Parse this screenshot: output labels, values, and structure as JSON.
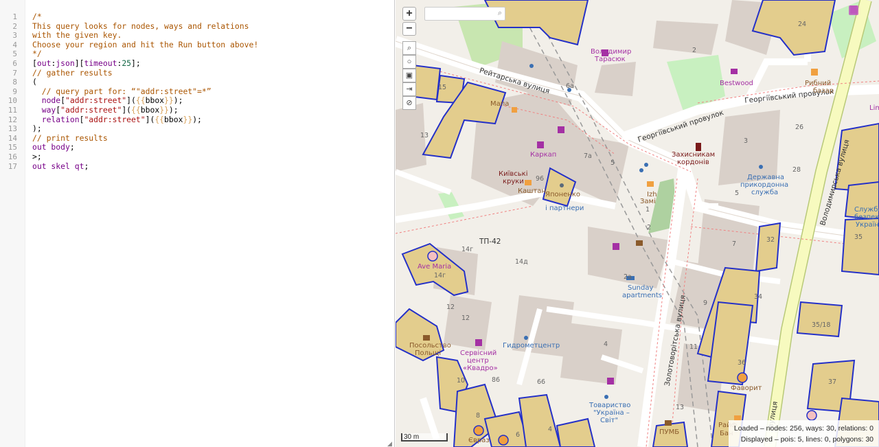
{
  "editor": {
    "line_numbers": [
      "1",
      "2",
      "3",
      "4",
      "5",
      "6",
      "7",
      "8",
      "9",
      "10",
      "11",
      "12",
      "13",
      "14",
      "15",
      "16",
      "17"
    ],
    "lines": [
      [
        {
          "t": "/*",
          "c": "comment"
        }
      ],
      [
        {
          "t": "This query looks for nodes, ways and relations",
          "c": "comment"
        }
      ],
      [
        {
          "t": "with the given key.",
          "c": "comment"
        }
      ],
      [
        {
          "t": "Choose your region and hit the Run button above!",
          "c": "comment"
        }
      ],
      [
        {
          "t": "*/",
          "c": "comment"
        }
      ],
      [
        {
          "t": "[",
          "c": ""
        },
        {
          "t": "out",
          "c": "kw"
        },
        {
          "t": ":",
          "c": ""
        },
        {
          "t": "json",
          "c": "kw"
        },
        {
          "t": "][",
          "c": ""
        },
        {
          "t": "timeout",
          "c": "kw"
        },
        {
          "t": ":",
          "c": ""
        },
        {
          "t": "25",
          "c": "num"
        },
        {
          "t": "];",
          "c": ""
        }
      ],
      [
        {
          "t": "// gather results",
          "c": "comment"
        }
      ],
      [
        {
          "t": "(",
          "c": ""
        }
      ],
      [
        {
          "t": "  // query part for: “\"addr:street\"=*”",
          "c": "comment"
        }
      ],
      [
        {
          "t": "  ",
          "c": ""
        },
        {
          "t": "node",
          "c": "kw"
        },
        {
          "t": "[",
          "c": ""
        },
        {
          "t": "\"addr:street\"",
          "c": "str"
        },
        {
          "t": "](",
          "c": ""
        },
        {
          "t": "{{",
          "c": "br"
        },
        {
          "t": "bbox",
          "c": ""
        },
        {
          "t": "}}",
          "c": "br"
        },
        {
          "t": ");",
          "c": ""
        }
      ],
      [
        {
          "t": "  ",
          "c": ""
        },
        {
          "t": "way",
          "c": "kw"
        },
        {
          "t": "[",
          "c": ""
        },
        {
          "t": "\"addr:street\"",
          "c": "str"
        },
        {
          "t": "](",
          "c": ""
        },
        {
          "t": "{{",
          "c": "br"
        },
        {
          "t": "bbox",
          "c": ""
        },
        {
          "t": "}}",
          "c": "br"
        },
        {
          "t": ");",
          "c": ""
        }
      ],
      [
        {
          "t": "  ",
          "c": ""
        },
        {
          "t": "relation",
          "c": "kw"
        },
        {
          "t": "[",
          "c": ""
        },
        {
          "t": "\"addr:street\"",
          "c": "str"
        },
        {
          "t": "](",
          "c": ""
        },
        {
          "t": "{{",
          "c": "br"
        },
        {
          "t": "bbox",
          "c": ""
        },
        {
          "t": "}}",
          "c": "br"
        },
        {
          "t": ");",
          "c": ""
        }
      ],
      [
        {
          "t": ");",
          "c": ""
        }
      ],
      [
        {
          "t": "// print results",
          "c": "comment"
        }
      ],
      [
        {
          "t": "out body",
          "c": "kw"
        },
        {
          "t": ";",
          "c": ""
        }
      ],
      [
        {
          "t": ">;",
          "c": ""
        }
      ],
      [
        {
          "t": "out skel qt",
          "c": "kw"
        },
        {
          "t": ";",
          "c": ""
        }
      ]
    ]
  },
  "map": {
    "controls": {
      "zoom_in": "+",
      "zoom_out": "−",
      "tools": [
        "search-icon",
        "circle-icon",
        "image-icon",
        "arrow-icon",
        "ban-icon"
      ]
    },
    "search_placeholder": "",
    "scale_label": "30 m",
    "status": {
      "loaded": "Loaded – nodes: 256, ways: 30, relations: 0",
      "displayed": "Displayed – pois: 5, lines: 0, polygons: 30"
    },
    "labels": [
      {
        "text": "Рейтарська вулиця",
        "style": "dark"
      },
      {
        "text": "Георгіївський провулок",
        "style": "dark"
      },
      {
        "text": "Георгіївський провулок",
        "style": "dark"
      },
      {
        "text": "Володимирська вулиця",
        "style": "dark"
      },
      {
        "text": "Золотоворітська вулиця",
        "style": "dark"
      },
      {
        "text": "вулиця",
        "style": "dark"
      },
      {
        "text": "Володимир",
        "style": "purple"
      },
      {
        "text": "Тарасюк",
        "style": "purple"
      },
      {
        "text": "Bestwood",
        "style": "purple"
      },
      {
        "text": "Рибний",
        "style": "brown"
      },
      {
        "text": "базар",
        "style": "brown"
      },
      {
        "text": "Мапа",
        "style": "brown"
      },
      {
        "text": "Каркап",
        "style": "purple"
      },
      {
        "text": "Київські",
        "style": "red"
      },
      {
        "text": "круки",
        "style": "red"
      },
      {
        "text": "Каштан",
        "style": "brown"
      },
      {
        "text": "Японенко",
        "style": "brown"
      },
      {
        "text": "і партнери",
        "style": "blue"
      },
      {
        "text": "Захисникам",
        "style": "red"
      },
      {
        "text": "кордонів",
        "style": "red"
      },
      {
        "text": "Державна",
        "style": "blue"
      },
      {
        "text": "прикордонна",
        "style": "blue"
      },
      {
        "text": "служба",
        "style": "blue"
      },
      {
        "text": "Служба",
        "style": "blue"
      },
      {
        "text": "безпеки",
        "style": "blue"
      },
      {
        "text": "України",
        "style": "blue"
      },
      {
        "text": "Izh",
        "style": "brown"
      },
      {
        "text": "Замі",
        "style": "brown"
      },
      {
        "text": "Ave Maria",
        "style": "purple"
      },
      {
        "text": "Sunday",
        "style": "blue"
      },
      {
        "text": "apartments",
        "style": "blue"
      },
      {
        "text": "Посольство",
        "style": "brown"
      },
      {
        "text": "Польщі",
        "style": "brown"
      },
      {
        "text": "Сервісний",
        "style": "purple"
      },
      {
        "text": "центр",
        "style": "purple"
      },
      {
        "text": "«Квадро»",
        "style": "purple"
      },
      {
        "text": "Гидрометцентр",
        "style": "blue"
      },
      {
        "text": "Товариство",
        "style": "blue"
      },
      {
        "text": "\"Україна –",
        "style": "blue"
      },
      {
        "text": "Світ\"",
        "style": "blue"
      },
      {
        "text": "Фаворит",
        "style": "brown"
      },
      {
        "text": "ПУМБ",
        "style": "brown"
      },
      {
        "text": "Райф",
        "style": "brown"
      },
      {
        "text": "Бан",
        "style": "brown"
      },
      {
        "text": "Євраз",
        "style": "brown"
      },
      {
        "text": "ТП-42",
        "style": "dark"
      },
      {
        "text": "Lim",
        "style": "purple"
      }
    ],
    "numbers": [
      "24",
      "2",
      "15",
      "6а",
      "13",
      "96",
      "7а",
      "5",
      "3",
      "26",
      "28",
      "5",
      "1",
      "7",
      "32",
      "34",
      "36",
      "37",
      "35/18",
      "9",
      "11",
      "13",
      "14г",
      "14г",
      "14д",
      "12",
      "12",
      "4",
      "66",
      "86",
      "10",
      "8",
      "6",
      "4",
      "2а",
      "35",
      "2",
      "Ave",
      "3"
    ]
  }
}
